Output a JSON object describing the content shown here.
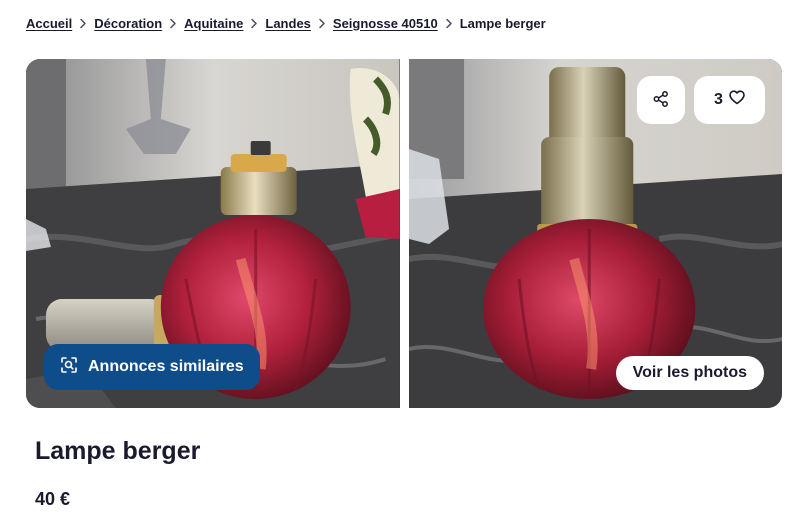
{
  "breadcrumb": {
    "items": [
      "Accueil",
      "Décoration",
      "Aquitaine",
      "Landes",
      "Seignosse 40510"
    ],
    "current": "Lampe berger"
  },
  "gallery": {
    "similar_button_label": "Annonces similaires",
    "see_photos_label": "Voir les photos",
    "favorite_count": "3",
    "icons": {
      "similar": "image-search-icon",
      "share": "share-icon",
      "favorite": "heart-icon"
    }
  },
  "listing": {
    "title": "Lampe berger",
    "price": "40 €"
  },
  "colors": {
    "accent": "#0f4c8a",
    "text": "#1a1a2e"
  }
}
